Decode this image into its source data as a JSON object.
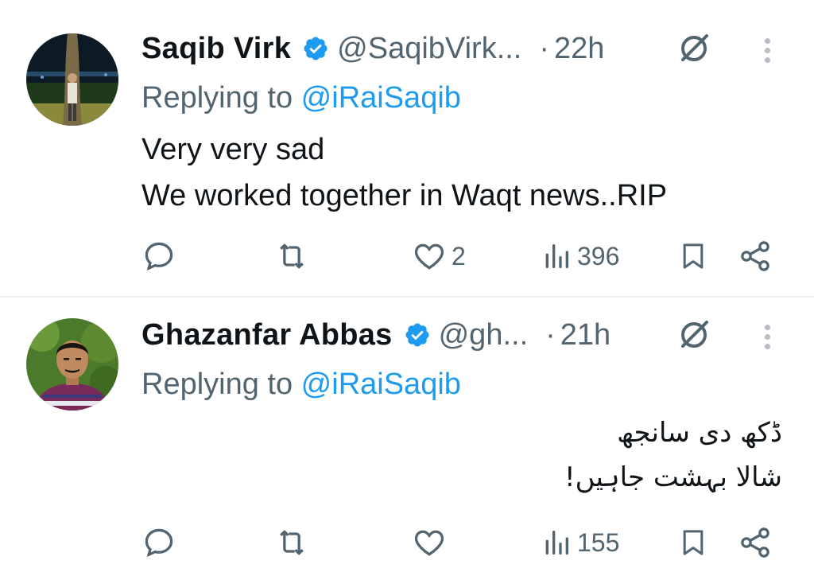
{
  "tweets": [
    {
      "name": "Saqib Virk",
      "handle": "@SaqibVirk...",
      "dot": "·",
      "time": "22h",
      "reply_prefix": "Replying to ",
      "reply_mention": "@iRaiSaqib",
      "lines": [
        "Very very sad",
        "We worked together in Waqt news..RIP"
      ],
      "replies": "",
      "retweets": "",
      "likes": "2",
      "views": "396"
    },
    {
      "name": "Ghazanfar Abbas",
      "handle": "@gh...",
      "dot": "·",
      "time": "21h",
      "reply_prefix": "Replying to ",
      "reply_mention": "@iRaiSaqib",
      "lines": [
        "ڈکھ دی سانجھ",
        "شالا بہشت جاہیں!"
      ],
      "replies": "",
      "retweets": "",
      "likes": "",
      "views": "155"
    }
  ],
  "icons": {
    "verified": "verified-badge-icon",
    "grok": "grok-icon",
    "more": "more-vertical-icon",
    "reply": "reply-icon",
    "retweet": "retweet-icon",
    "like": "heart-icon",
    "views": "views-chart-icon",
    "bookmark": "bookmark-icon",
    "share": "share-icon"
  },
  "colors": {
    "accent": "#1d9bf0",
    "muted": "#536471",
    "text": "#0f1419"
  }
}
